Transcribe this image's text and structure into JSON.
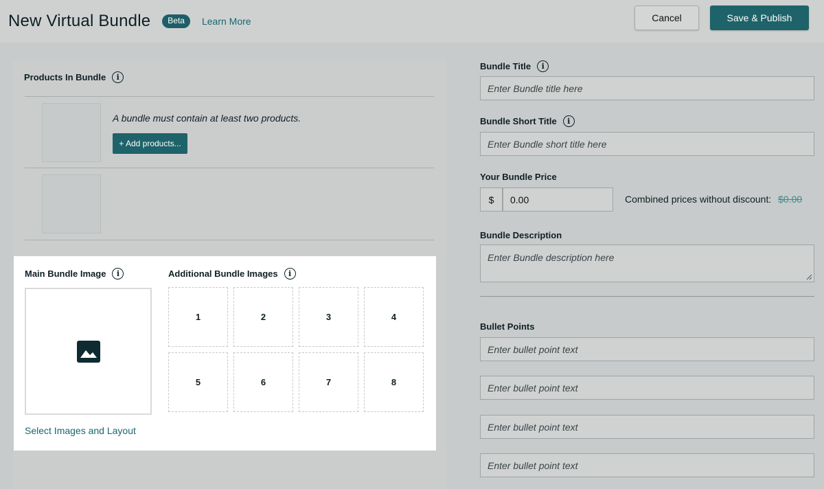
{
  "header": {
    "title": "New Virtual Bundle",
    "badge": "Beta",
    "learn_more": "Learn More",
    "cancel_label": "Cancel",
    "publish_label": "Save & Publish"
  },
  "products": {
    "heading": "Products In Bundle",
    "note": "A bundle must contain at least two products.",
    "add_button": "+ Add products..."
  },
  "images": {
    "main_heading": "Main Bundle Image",
    "additional_heading": "Additional Bundle Images",
    "slots": [
      "1",
      "2",
      "3",
      "4",
      "5",
      "6",
      "7",
      "8"
    ],
    "select_link": "Select Images and Layout"
  },
  "form": {
    "title_label": "Bundle Title",
    "title_placeholder": "Enter Bundle title here",
    "short_title_label": "Bundle Short Title",
    "short_title_placeholder": "Enter Bundle short title here",
    "price_label": "Your Bundle Price",
    "currency": "$",
    "price_value": "0.00",
    "combined_label": "Combined prices without discount:",
    "combined_value": "$0.00",
    "description_label": "Bundle Description",
    "description_placeholder": "Enter Bundle description here",
    "bullets_label": "Bullet Points",
    "bullet_placeholders": [
      "Enter bullet point text",
      "Enter bullet point text",
      "Enter bullet point text",
      "Enter bullet point text"
    ]
  },
  "colors": {
    "accent": "#1e6369",
    "link": "#16676f"
  }
}
